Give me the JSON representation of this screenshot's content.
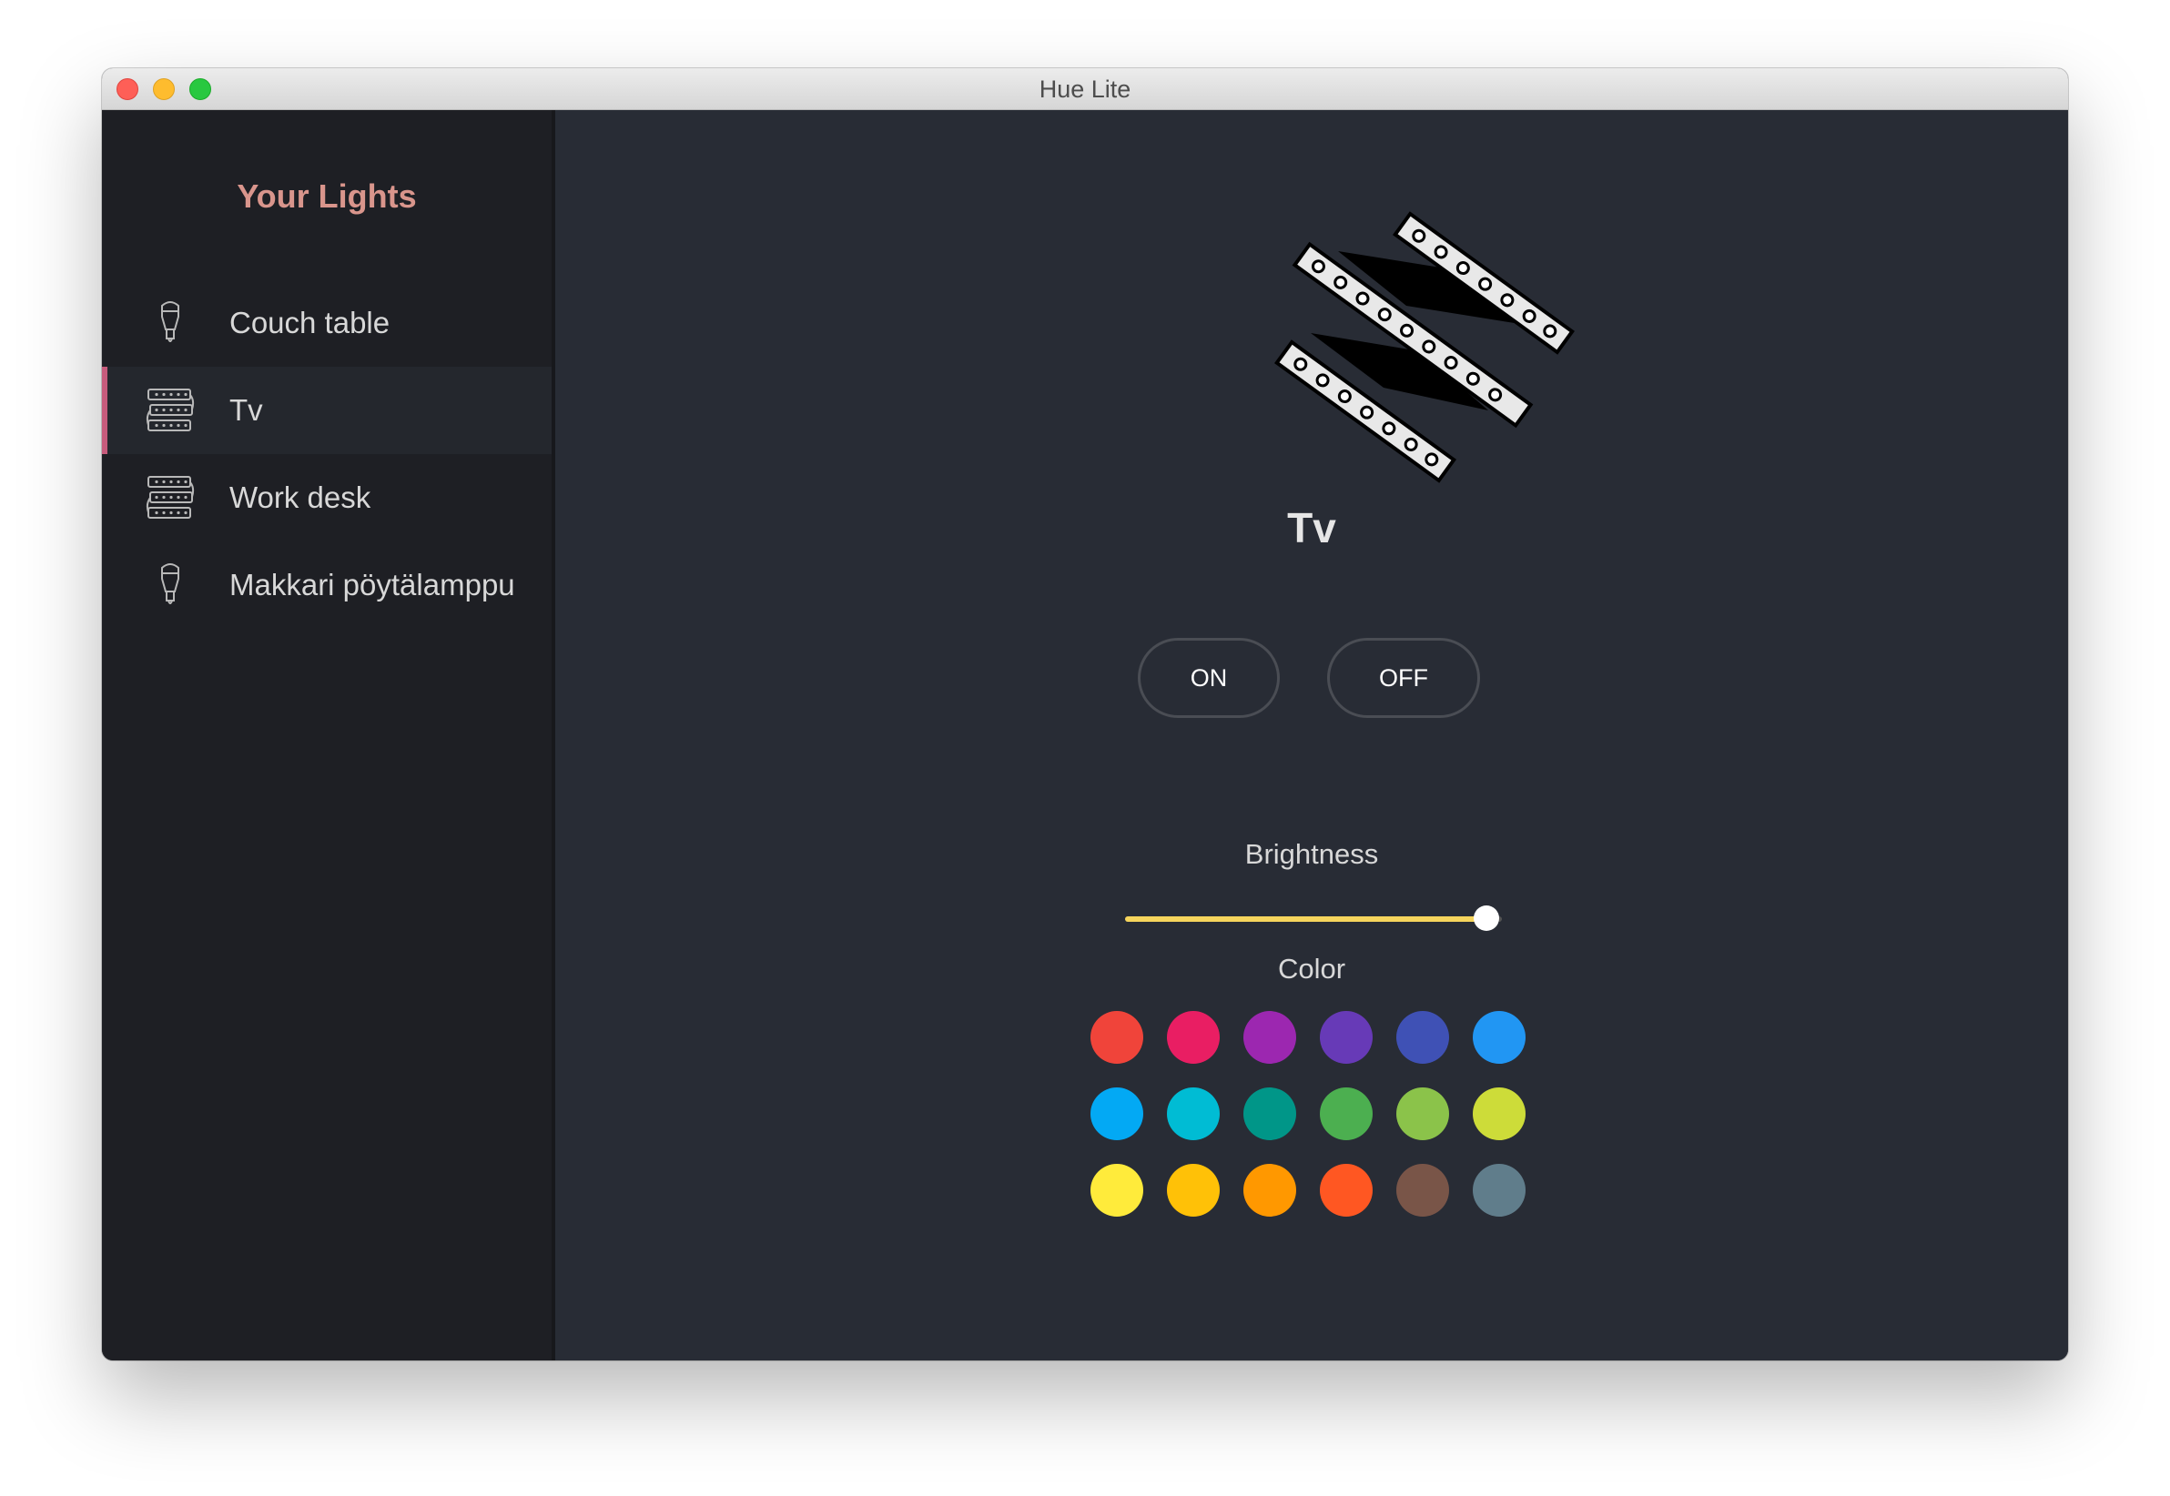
{
  "window": {
    "title": "Hue Lite"
  },
  "sidebar": {
    "title": "Your Lights",
    "items": [
      {
        "label": "Couch table",
        "icon": "bulb-icon",
        "active": false
      },
      {
        "label": "Tv",
        "icon": "lightstrip-icon",
        "active": true
      },
      {
        "label": "Work desk",
        "icon": "lightstrip-icon",
        "active": false
      },
      {
        "label": "Makkari pöytälamppu",
        "icon": "bulb-icon",
        "active": false
      }
    ]
  },
  "detail": {
    "name": "Tv",
    "image": "lightstrip-image",
    "on_label": "ON",
    "off_label": "OFF",
    "brightness_label": "Brightness",
    "brightness_value": 0.96,
    "color_label": "Color"
  },
  "colors": {
    "accent": "#c75b7c",
    "title": "#d9958c",
    "slider_fill": "#f6d55c",
    "swatches": [
      "#f0443a",
      "#e91e63",
      "#9c27b0",
      "#673ab7",
      "#3f51b5",
      "#2196f3",
      "#03a9f4",
      "#00bcd4",
      "#009688",
      "#4caf50",
      "#8bc34a",
      "#cddc39",
      "#ffeb3b",
      "#ffc107",
      "#ff9800",
      "#ff5722",
      "#795548",
      "#607d8b"
    ]
  }
}
